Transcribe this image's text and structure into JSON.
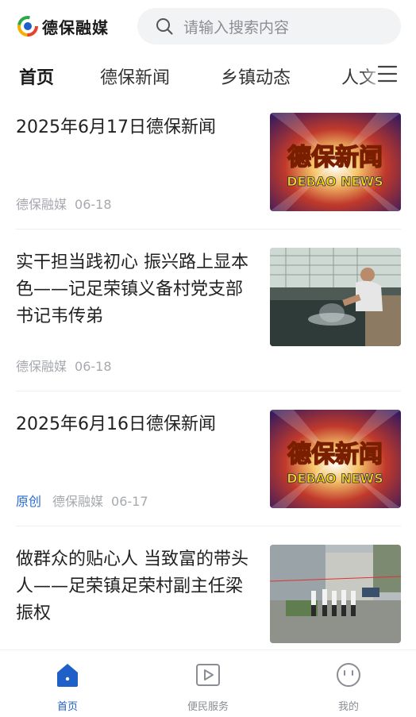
{
  "header": {
    "brand_name": "德保融媒",
    "search_placeholder": "请输入搜索内容"
  },
  "tabs": [
    {
      "label": "首页",
      "active": true
    },
    {
      "label": "德保新闻",
      "active": false
    },
    {
      "label": "乡镇动态",
      "active": false
    },
    {
      "label": "人文",
      "active": false
    }
  ],
  "news": [
    {
      "title": "2025年6月17日德保新闻",
      "tag": "",
      "source": "德保融媒",
      "date": "06-18",
      "thumb_text": "德保新闻",
      "thumb_sub": "DEBAO NEWS",
      "thumb_type": "news-banner"
    },
    {
      "title": "实干担当践初心 振兴路上显本色——记足荣镇义备村党支部书记韦传弟",
      "tag": "",
      "source": "德保融媒",
      "date": "06-18",
      "thumb_type": "photo-fish-farm"
    },
    {
      "title": "2025年6月16日德保新闻",
      "tag": "原创",
      "source": "德保融媒",
      "date": "06-17",
      "thumb_text": "德保新闻",
      "thumb_sub": "DEBAO NEWS",
      "thumb_type": "news-banner"
    },
    {
      "title": "做群众的贴心人 当致富的带头人——足荣镇足荣村副主任梁振权",
      "tag": "",
      "source": "",
      "date": "",
      "thumb_type": "photo-village-group"
    }
  ],
  "bottom_nav": [
    {
      "label": "首页",
      "icon": "home-icon",
      "active": true
    },
    {
      "label": "便民服务",
      "icon": "play-square-icon",
      "active": false
    },
    {
      "label": "我的",
      "icon": "smiley-icon",
      "active": false
    }
  ],
  "colors": {
    "accent": "#1f5fc8",
    "tag_blue": "#2a6bd1",
    "meta_gray": "#a6a9ae",
    "search_bg": "#f2f3f5"
  }
}
